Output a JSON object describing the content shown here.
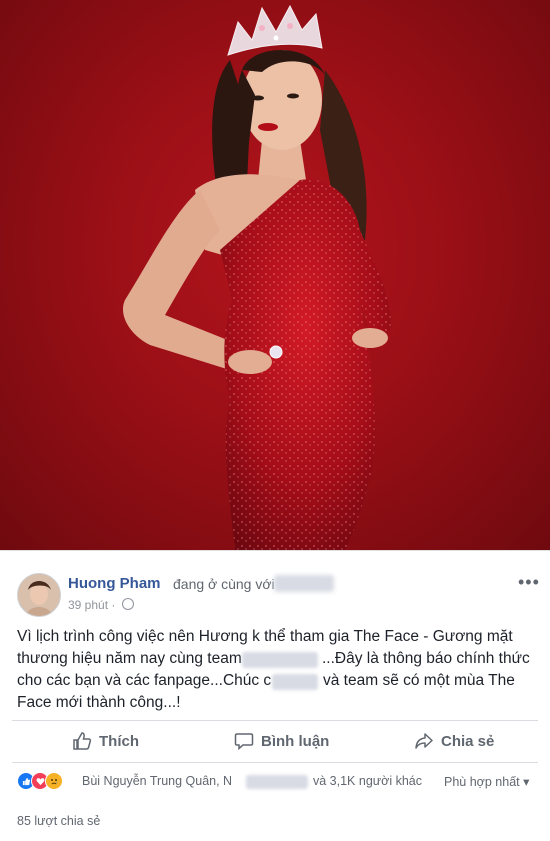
{
  "post": {
    "author": "Huong Pham",
    "with_text": "đang ở cùng với",
    "time": "39 phút",
    "dot": "·",
    "lines": [
      "Vì lịch trình công việc nên Hương k thể tham gia The Face - Gương mặt",
      "thương hiệu năm nay cùng team",
      "...Đây là thông báo chính thức",
      "cho các bạn và các fanpage...Chúc c",
      "và team sẽ có một mùa The",
      "Face mới thành công...!"
    ]
  },
  "actions": {
    "like": "Thích",
    "comment": "Bình luận",
    "share": "Chia sẻ"
  },
  "reactions": {
    "names": "Bùi Nguyễn Trung Quân, N",
    "others": "và 3,1K người khác",
    "sort": "Phù hợp nhất ▾"
  },
  "shares": "85 lượt chia sẻ",
  "icons": [
    "more-icon",
    "globe-icon",
    "like-icon",
    "comment-icon",
    "share-icon",
    "like-reaction-icon",
    "love-reaction-icon",
    "sad-reaction-icon"
  ],
  "colors": {
    "photo_bg": "#9a0f16",
    "dress": "#b0101c",
    "author": "#365899",
    "like_blue": "#1877f2",
    "love_red": "#f33e58",
    "sad_yellow": "#f7b125"
  }
}
